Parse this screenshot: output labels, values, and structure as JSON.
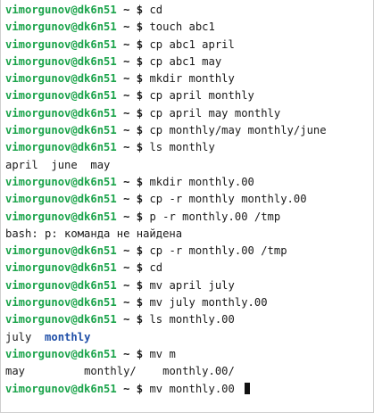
{
  "terminal": {
    "prompt_user_host": "vimorgunov@dk6n51",
    "prompt_path": "~",
    "prompt_symbol": "$",
    "commands": [
      "cd",
      "touch abc1",
      "cp abc1 april",
      "cp abc1 may",
      "mkdir monthly",
      "cp april monthly",
      "cp april may monthly",
      "cp monthly/may monthly/june",
      "ls monthly",
      "mkdir monthly.00",
      "cp -r monthly monthly.00",
      "p -r monthly.00 /tmp",
      "cp -r monthly.00 /tmp",
      "cd",
      "mv april july",
      "mv july monthly.00",
      "ls monthly.00",
      "mv m",
      "mv monthly.00 "
    ],
    "outputs": {
      "ls_monthly": "april  june  may",
      "bash_error": "bash: p: команда не найдена",
      "ls_monthly00_file": "july",
      "ls_monthly00_dir": "monthly",
      "completion_may": "may",
      "completion_monthly": "monthly/",
      "completion_monthly00": "monthly.00/"
    }
  },
  "colors": {
    "background": "#ffffff",
    "prompt_green": "#1aa34a",
    "directory_blue": "#1f4fa8",
    "text": "#1a1a1a"
  }
}
